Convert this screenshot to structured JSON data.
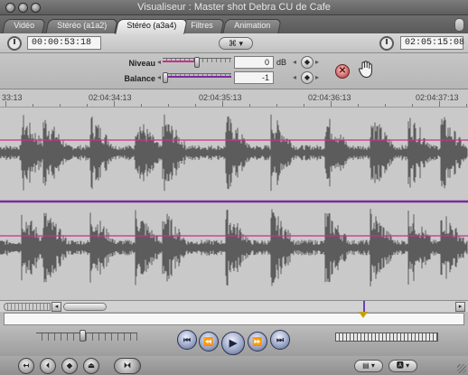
{
  "window": {
    "title": "Visualiseur : Master shot Debra CU de Cafe"
  },
  "tabs": [
    {
      "label": "Vidéo",
      "active": false
    },
    {
      "label": "Stéréo (a1a2)",
      "active": false
    },
    {
      "label": "Stéréo (a3a4)",
      "active": true
    },
    {
      "label": "Filtres",
      "active": false
    },
    {
      "label": "Animation",
      "active": false
    }
  ],
  "toolbar": {
    "timecode_left": "00:00:53:18",
    "timecode_right": "02:05:15:08",
    "center_button": "⌘ ▾"
  },
  "controls": {
    "level_label": "Niveau",
    "level_value": "0",
    "level_unit": "dB",
    "balance_label": "Balance",
    "balance_value": "-1",
    "reset_symbol": "✕",
    "keyframe_symbol": "◆",
    "level_fill": 0.5,
    "balance_fill": 0.0
  },
  "ruler": {
    "labels": [
      "33:13",
      "02:04:34:13",
      "02:04:35:13",
      "02:04:36:13",
      "02:04:37:13"
    ]
  },
  "transport": {
    "buttons": [
      "⏮",
      "⏪",
      "▶",
      "⏩",
      "⏭"
    ]
  },
  "bottom": {
    "buttons": [
      "↤",
      "⏴",
      "◆",
      "⏏",
      "⏵⏴"
    ],
    "popup_left": "▤ ▾",
    "popup_right": "🅰 ▾"
  },
  "colors": {
    "level_line": "#cc2f8e",
    "balance_line": "#7b2aa0",
    "waveform": "#5c5c5c"
  }
}
